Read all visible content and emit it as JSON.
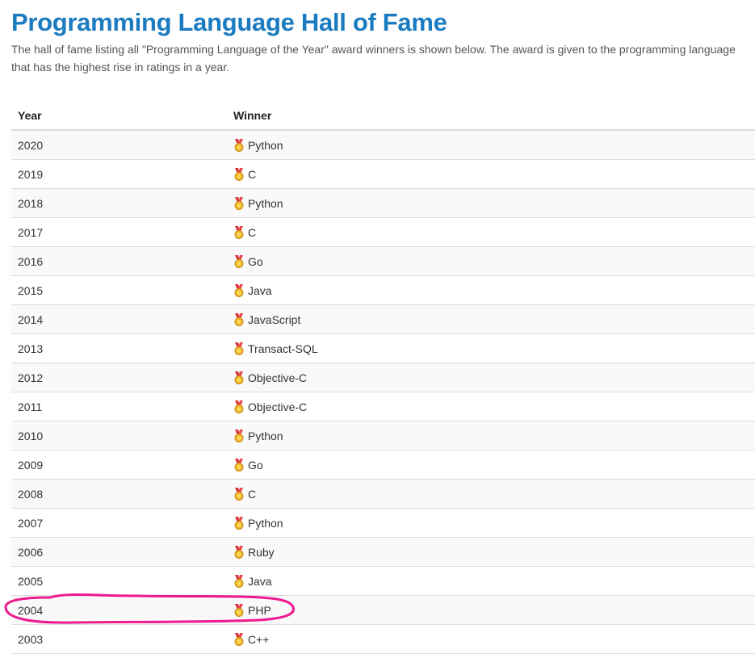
{
  "page": {
    "title": "Programming Language Hall of Fame",
    "intro": "The hall of fame listing all \"Programming Language of the Year\" award winners is shown below. The award is given to the programming language that has the highest rise in ratings in a year."
  },
  "table": {
    "headers": {
      "year": "Year",
      "winner": "Winner"
    },
    "winner_icon": "medal-icon",
    "rows": [
      {
        "year": "2020",
        "winner": "Python"
      },
      {
        "year": "2019",
        "winner": "C"
      },
      {
        "year": "2018",
        "winner": "Python"
      },
      {
        "year": "2017",
        "winner": "C"
      },
      {
        "year": "2016",
        "winner": "Go"
      },
      {
        "year": "2015",
        "winner": "Java"
      },
      {
        "year": "2014",
        "winner": "JavaScript"
      },
      {
        "year": "2013",
        "winner": "Transact-SQL"
      },
      {
        "year": "2012",
        "winner": "Objective-C"
      },
      {
        "year": "2011",
        "winner": "Objective-C"
      },
      {
        "year": "2010",
        "winner": "Python"
      },
      {
        "year": "2009",
        "winner": "Go"
      },
      {
        "year": "2008",
        "winner": "C"
      },
      {
        "year": "2007",
        "winner": "Python"
      },
      {
        "year": "2006",
        "winner": "Ruby"
      },
      {
        "year": "2005",
        "winner": "Java"
      },
      {
        "year": "2004",
        "winner": "PHP"
      },
      {
        "year": "2003",
        "winner": "C++"
      }
    ]
  },
  "annotation": {
    "highlighted_year": "2004",
    "color": "#ee1a8f"
  },
  "colors": {
    "title": "#1b7bc1",
    "stripe": "#f9f9f9",
    "border": "#dddddd"
  }
}
